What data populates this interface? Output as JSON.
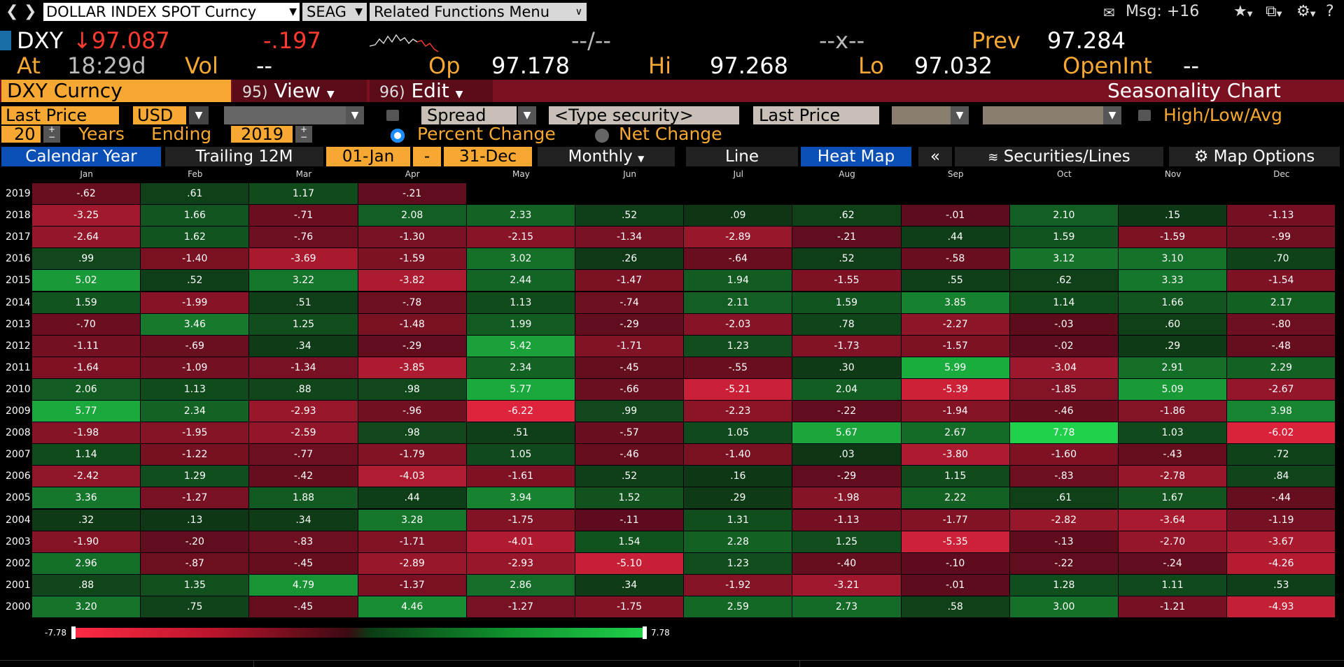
{
  "topbar": {
    "security": "DOLLAR INDEX SPOT Curncy",
    "function": "SEAG",
    "related": "Related Functions  Menu",
    "msg": "Msg: +16"
  },
  "quote": {
    "ticker": "DXY",
    "last": "↓97.087",
    "change": "-.197",
    "bidask": "--/--",
    "size": "--x--",
    "prev_label": "Prev",
    "prev": "97.284",
    "at_label": "At",
    "time": "18:29d",
    "vol_label": "Vol",
    "vol": "--",
    "op_label": "Op",
    "op": "97.178",
    "hi_label": "Hi",
    "hi": "97.268",
    "lo_label": "Lo",
    "lo": "97.032",
    "oi_label": "OpenInt",
    "oi": "--"
  },
  "title_row": {
    "security": "DXY Curncy",
    "view_num": "95)",
    "view": "View",
    "edit_num": "96)",
    "edit": "Edit",
    "chart_title": "Seasonality Chart"
  },
  "controls": {
    "field": "Last Price",
    "currency": "USD",
    "spread": "Spread",
    "type_security": "<Type security>",
    "field2": "Last Price",
    "hla": "High/Low/Avg",
    "years": "20",
    "years_label": "Years",
    "ending_label": "Ending",
    "ending_year": "2019",
    "percent_change": "Percent Change",
    "net_change": "Net Change"
  },
  "tabs": {
    "calendar_year": "Calendar Year",
    "trailing": "Trailing 12M",
    "start": "01-Jan",
    "dash": "-",
    "end": "31-Dec",
    "period": "Monthly",
    "line": "Line",
    "heat_map": "Heat Map",
    "collapse": "«",
    "securities_lines": "Securities/Lines",
    "map_options": "Map Options"
  },
  "colors": {
    "accent_amber": "#f7a832",
    "title_bar": "#7b1021",
    "tab_blue": "#0a4fb5",
    "pos_max": "#1fd04a",
    "neg_max": "#ff2a44"
  },
  "chart_data": {
    "type": "heatmap",
    "title": "Seasonality Chart",
    "columns": [
      "Jan",
      "Feb",
      "Mar",
      "Apr",
      "May",
      "Jun",
      "Jul",
      "Aug",
      "Sep",
      "Oct",
      "Nov",
      "Dec"
    ],
    "range": [
      -7.78,
      7.78
    ],
    "legend_min": "-7.78",
    "legend_max": "7.78",
    "rows": [
      {
        "year": "2019",
        "values": [
          "-.62",
          ".61",
          "1.17",
          "-.21"
        ]
      },
      {
        "year": "2018",
        "values": [
          "-3.25",
          "1.66",
          "-.71",
          "2.08",
          "2.33",
          ".52",
          ".09",
          ".62",
          "-.01",
          "2.10",
          ".15",
          "-1.13"
        ]
      },
      {
        "year": "2017",
        "values": [
          "-2.64",
          "1.62",
          "-.76",
          "-1.30",
          "-2.15",
          "-1.34",
          "-2.89",
          "-.21",
          ".44",
          "1.59",
          "-1.59",
          "-.99"
        ]
      },
      {
        "year": "2016",
        "values": [
          ".99",
          "-1.40",
          "-3.69",
          "-1.59",
          "3.02",
          ".26",
          "-.64",
          ".52",
          "-.58",
          "3.12",
          "3.10",
          ".70"
        ]
      },
      {
        "year": "2015",
        "values": [
          "5.02",
          ".52",
          "3.22",
          "-3.82",
          "2.44",
          "-1.47",
          "1.94",
          "-1.55",
          ".55",
          ".62",
          "3.33",
          "-1.54"
        ]
      },
      {
        "year": "2014",
        "values": [
          "1.59",
          "-1.99",
          ".51",
          "-.78",
          "1.13",
          "-.74",
          "2.11",
          "1.59",
          "3.85",
          "1.14",
          "1.66",
          "2.17"
        ]
      },
      {
        "year": "2013",
        "values": [
          "-.70",
          "3.46",
          "1.25",
          "-1.48",
          "1.99",
          "-.29",
          "-2.03",
          ".78",
          "-2.27",
          "-.03",
          ".60",
          "-.80"
        ]
      },
      {
        "year": "2012",
        "values": [
          "-1.11",
          "-.69",
          ".34",
          "-.29",
          "5.42",
          "-1.71",
          "1.23",
          "-1.73",
          "-1.57",
          "-.02",
          ".29",
          "-.48"
        ]
      },
      {
        "year": "2011",
        "values": [
          "-1.64",
          "-1.09",
          "-1.34",
          "-3.85",
          "2.34",
          "-.45",
          "-.55",
          ".30",
          "5.99",
          "-3.04",
          "2.91",
          "2.29"
        ]
      },
      {
        "year": "2010",
        "values": [
          "2.06",
          "1.13",
          ".88",
          ".98",
          "5.77",
          "-.66",
          "-5.21",
          "2.04",
          "-5.39",
          "-1.85",
          "5.09",
          "-2.67"
        ]
      },
      {
        "year": "2009",
        "values": [
          "5.77",
          "2.34",
          "-2.93",
          "-.96",
          "-6.22",
          ".99",
          "-2.23",
          "-.22",
          "-1.94",
          "-.46",
          "-1.86",
          "3.98"
        ]
      },
      {
        "year": "2008",
        "values": [
          "-1.98",
          "-1.95",
          "-2.59",
          ".98",
          ".51",
          "-.57",
          "1.05",
          "5.67",
          "2.67",
          "7.78",
          "1.03",
          "-6.02"
        ]
      },
      {
        "year": "2007",
        "values": [
          "1.14",
          "-1.22",
          "-.77",
          "-1.79",
          "1.05",
          "-.46",
          "-1.40",
          ".03",
          "-3.80",
          "-1.60",
          "-.43",
          ".72"
        ]
      },
      {
        "year": "2006",
        "values": [
          "-2.42",
          "1.29",
          "-.42",
          "-4.03",
          "-1.61",
          ".52",
          ".16",
          "-.29",
          "1.15",
          "-.83",
          "-2.78",
          ".84"
        ]
      },
      {
        "year": "2005",
        "values": [
          "3.36",
          "-1.27",
          "1.88",
          ".44",
          "3.94",
          "1.52",
          ".29",
          "-1.98",
          "2.22",
          ".61",
          "1.67",
          "-.44"
        ]
      },
      {
        "year": "2004",
        "values": [
          ".32",
          ".13",
          ".34",
          "3.28",
          "-1.75",
          "-.11",
          "1.31",
          "-1.13",
          "-1.77",
          "-2.82",
          "-3.64",
          "-1.19"
        ]
      },
      {
        "year": "2003",
        "values": [
          "-1.90",
          "-.20",
          "-.83",
          "-1.71",
          "-4.01",
          "1.54",
          "2.28",
          "1.25",
          "-5.35",
          "-.13",
          "-2.70",
          "-3.67"
        ]
      },
      {
        "year": "2002",
        "values": [
          "2.96",
          "-.87",
          "-.45",
          "-2.89",
          "-2.93",
          "-5.10",
          "1.23",
          "-.40",
          "-.10",
          "-.22",
          "-.24",
          "-4.26"
        ]
      },
      {
        "year": "2001",
        "values": [
          ".88",
          "1.35",
          "4.79",
          "-1.37",
          "2.86",
          ".34",
          "-1.92",
          "-3.21",
          "-.01",
          "1.28",
          "1.11",
          ".53"
        ]
      },
      {
        "year": "2000",
        "values": [
          "3.20",
          ".75",
          "-.45",
          "4.46",
          "-1.27",
          "-1.75",
          "2.59",
          "2.73",
          ".58",
          "3.00",
          "-1.21",
          "-4.93"
        ]
      }
    ]
  }
}
